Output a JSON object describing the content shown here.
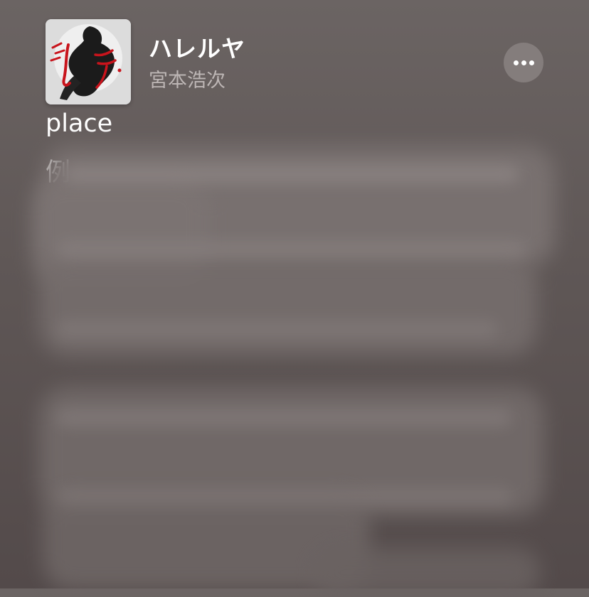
{
  "track": {
    "title": "ハレルヤ",
    "artist": "宮本浩次"
  },
  "actions": {
    "more_icon": "ellipsis-icon"
  },
  "lyrics": {
    "visible_lines": [
      "place",
      "例"
    ]
  },
  "colors": {
    "background_top": "#6b6463",
    "background_bottom": "#534a4a",
    "artist_text": "#bdb6b5",
    "button_bg": "#847d7c",
    "art_accent": "#c8141c"
  }
}
